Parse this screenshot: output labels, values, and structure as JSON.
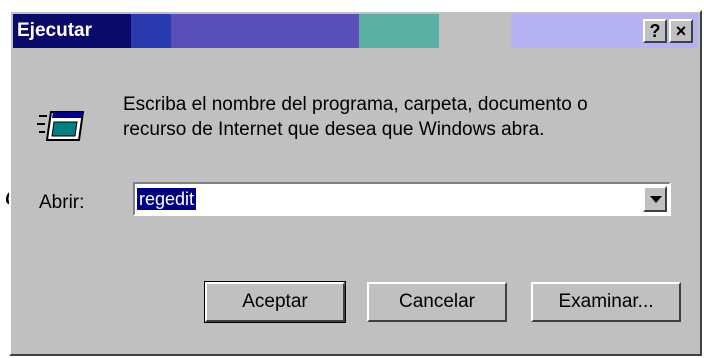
{
  "stray_glyph": "a",
  "dialog": {
    "title": "Ejecutar",
    "help_label": "?",
    "close_label": "×",
    "description_line1": "Escriba el nombre del programa, carpeta, documento o",
    "description_line2": "recurso de Internet que desea que Windows abra.",
    "open_label": "Abrir:",
    "open_value": "regedit",
    "buttons": {
      "ok": "Aceptar",
      "cancel": "Cancelar",
      "browse": "Examinar..."
    },
    "icons": {
      "run": "run-program-icon",
      "dropdown": "chevron-down-icon"
    }
  },
  "colors": {
    "titlebar_segments": [
      "#0a0a6a",
      "#2a3bb0",
      "#5a4fb8",
      "#5bb0a4",
      "#c0c0c0",
      "#b7b2f2"
    ],
    "selection": "#000080",
    "face": "#c0c0c0"
  }
}
